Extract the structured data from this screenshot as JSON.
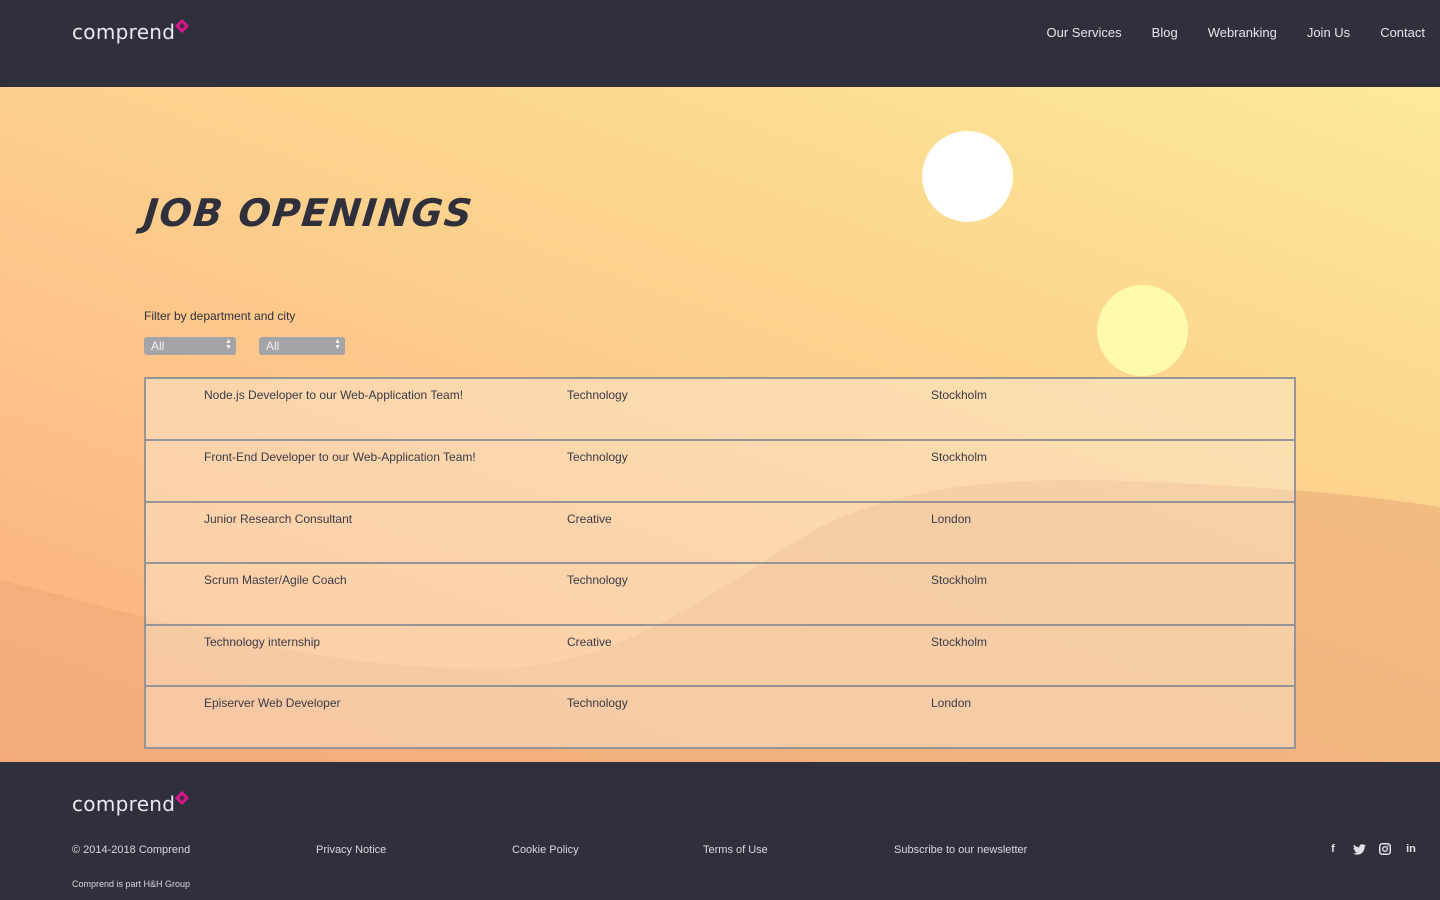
{
  "header": {
    "logo_text": "comprend",
    "nav": [
      {
        "label": "Our Services"
      },
      {
        "label": "Blog"
      },
      {
        "label": "Webranking"
      },
      {
        "label": "Join Us"
      },
      {
        "label": "Contact"
      }
    ]
  },
  "hero": {
    "title": "JOB OPENINGS",
    "filter_label": "Filter by department and city",
    "department_select": {
      "value": "All"
    },
    "city_select": {
      "value": "All"
    }
  },
  "jobs": [
    {
      "title": "Node.js Developer to our Web-Application Team!",
      "department": "Technology",
      "city": "Stockholm"
    },
    {
      "title": "Front-End Developer to our Web-Application Team!",
      "department": "Technology",
      "city": "Stockholm"
    },
    {
      "title": "Junior Research Consultant",
      "department": "Creative",
      "city": "London"
    },
    {
      "title": "Scrum Master/Agile Coach",
      "department": "Technology",
      "city": "Stockholm"
    },
    {
      "title": "Technology internship",
      "department": "Creative",
      "city": "Stockholm"
    },
    {
      "title": "Episerver Web Developer",
      "department": "Technology",
      "city": "London"
    }
  ],
  "footer": {
    "logo_text": "comprend",
    "copyright": "© 2014-2018 Comprend",
    "privacy": "Privacy Notice",
    "cookie": "Cookie Policy",
    "terms": "Terms of Use",
    "newsletter": "Subscribe to our newsletter",
    "group_note": "Comprend is part H&H Group",
    "social": [
      "facebook-icon",
      "twitter-icon",
      "instagram-icon",
      "linkedin-icon"
    ]
  },
  "colors": {
    "dark": "#2f303c",
    "brand_accent": "#d6178a",
    "sun": "#ffffff",
    "sun_yellow": "#fdfaac"
  }
}
